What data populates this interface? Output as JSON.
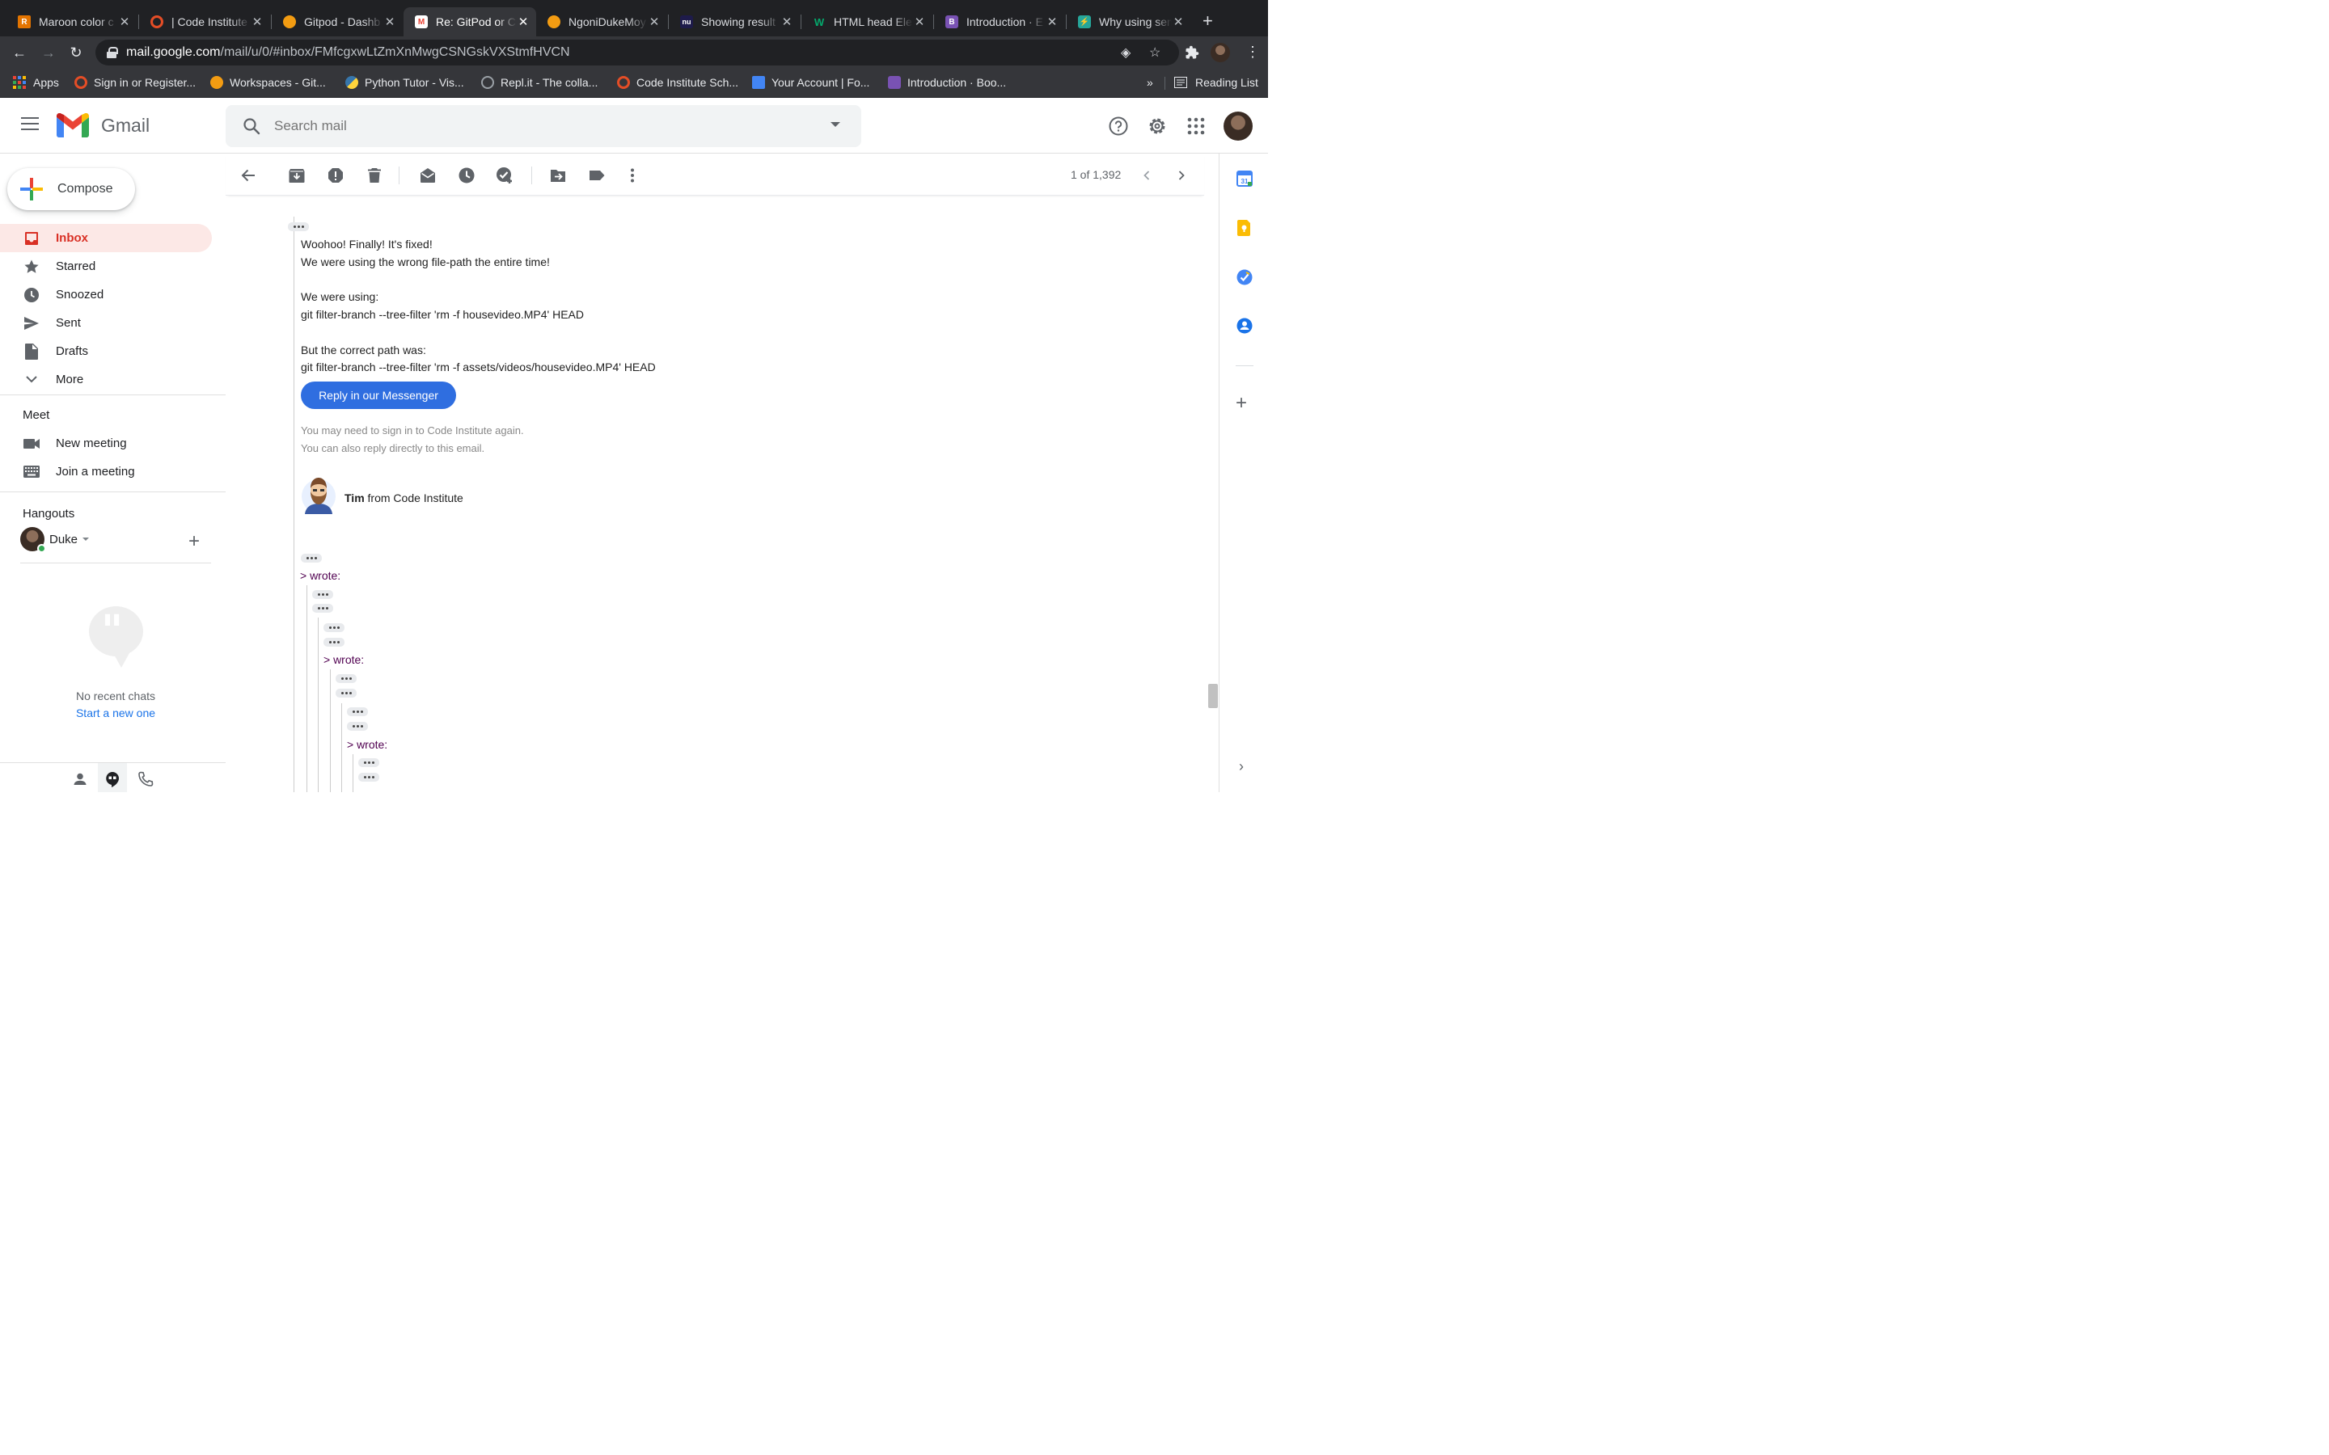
{
  "browser": {
    "tabs": [
      {
        "title": "Maroon color c",
        "favicon": "R",
        "color": "#e37400"
      },
      {
        "title": "| Code Institute",
        "favicon": "",
        "color": "#e44d26"
      },
      {
        "title": "Gitpod - Dashb",
        "favicon": "",
        "color": "#f39c12"
      },
      {
        "title": "Re: GitPod or C",
        "favicon": "M",
        "color": "#ea4335"
      },
      {
        "title": "NgoniDukeMoy",
        "favicon": "",
        "color": "#f39c12"
      },
      {
        "title": "Showing result",
        "favicon": "nu",
        "color": "#1e1b4b"
      },
      {
        "title": "HTML head Ele",
        "favicon": "W",
        "color": "#04aa6d"
      },
      {
        "title": "Introduction · E",
        "favicon": "B",
        "color": "#7952b3"
      },
      {
        "title": "Why using sem",
        "favicon": "⚡",
        "color": "#26a69a"
      }
    ],
    "url_host": "mail.google.com",
    "url_path": "/mail/u/0/#inbox/FMfcgxwLtZmXnMwgCSNGskVXStmfHVCN",
    "bookmarks": [
      {
        "label": "Apps",
        "color": "#4285f4"
      },
      {
        "label": "Sign in or Register...",
        "color": "#e44d26"
      },
      {
        "label": "Workspaces - Git...",
        "color": "#f39c12"
      },
      {
        "label": "Python Tutor - Vis...",
        "color": "#3776ab"
      },
      {
        "label": "Repl.it - The colla...",
        "color": "#9aa0a6"
      },
      {
        "label": "Code Institute Sch...",
        "color": "#e44d26"
      },
      {
        "label": "Your Account | Fo...",
        "color": "#4285f4"
      },
      {
        "label": "Introduction · Boo...",
        "color": "#7952b3"
      }
    ],
    "bookmarks_more": "»",
    "reading_list": "Reading List"
  },
  "gmail": {
    "brand": "Gmail",
    "search_placeholder": "Search mail",
    "compose_label": "Compose",
    "nav": [
      {
        "label": "Inbox",
        "icon": "inbox-icon"
      },
      {
        "label": "Starred",
        "icon": "star-icon"
      },
      {
        "label": "Snoozed",
        "icon": "clock-icon"
      },
      {
        "label": "Sent",
        "icon": "send-icon"
      },
      {
        "label": "Drafts",
        "icon": "draft-icon"
      },
      {
        "label": "More",
        "icon": "chevron-down-icon"
      }
    ],
    "meet": {
      "title": "Meet",
      "items": [
        {
          "label": "New meeting",
          "icon": "video-icon"
        },
        {
          "label": "Join a meeting",
          "icon": "keyboard-icon"
        }
      ]
    },
    "hangouts": {
      "title": "Hangouts",
      "user": "Duke",
      "no_chats": "No recent chats",
      "start_new": "Start a new one"
    },
    "pager": "1 of 1,392",
    "accent_red": "#d93025",
    "accent_blue": "#1a73e8"
  },
  "email": {
    "lines": [
      "Woohoo! Finally! It's fixed!",
      "We were using the wrong file-path the entire time!",
      "We were using:",
      "git filter-branch --tree-filter 'rm -f housevideo.MP4' HEAD",
      "But the correct path was:",
      "git filter-branch --tree-filter 'rm -f assets/videos/housevideo.MP4' HEAD"
    ],
    "reply_button": "Reply in our Messenger",
    "note1": "You may need to sign in to Code Institute again.",
    "note2": "You can also reply directly to this email.",
    "sender_name": "Tim",
    "sender_suffix": " from Code Institute",
    "wrote": "> wrote:"
  }
}
